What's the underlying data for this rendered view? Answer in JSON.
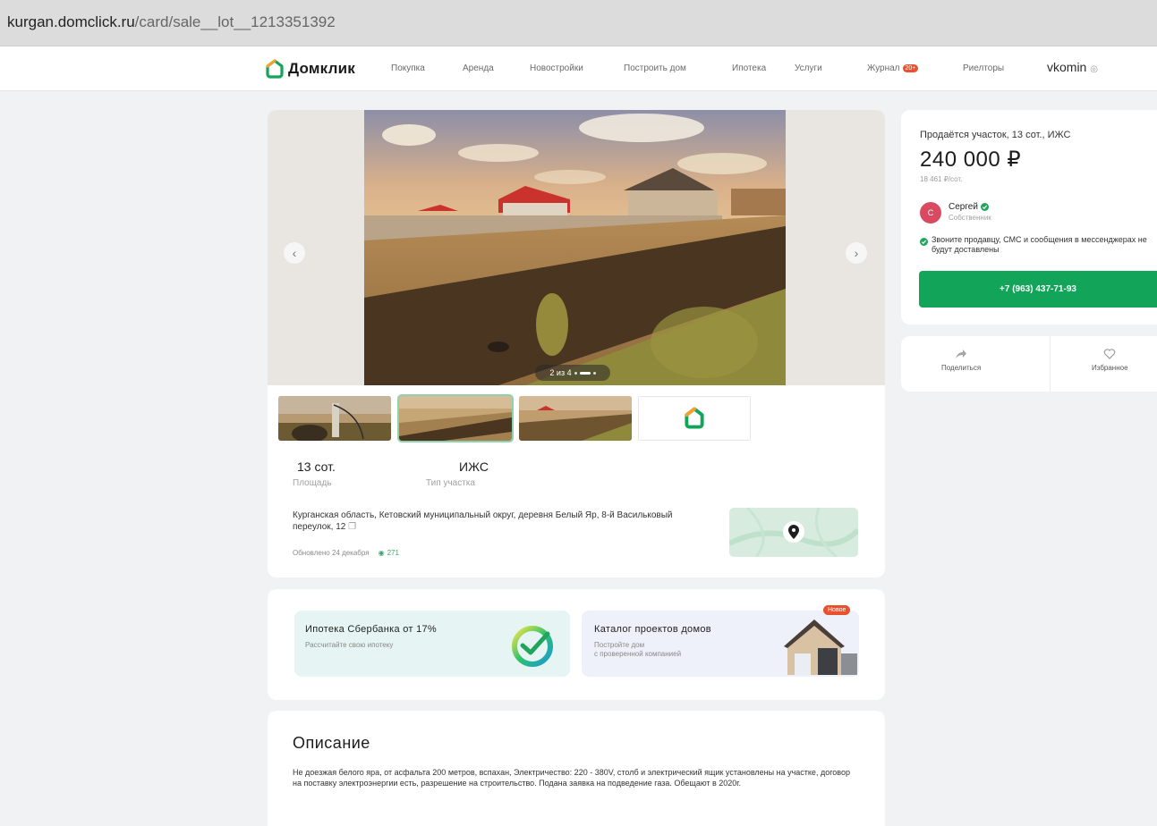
{
  "browser": {
    "url_host": "kurgan.domclick.ru",
    "url_path": "/card/sale__lot__1213351392"
  },
  "nav": {
    "brand": "Домклик",
    "items": [
      "Покупка",
      "Аренда",
      "Новостройки",
      "Построить дом",
      "Ипотека",
      "Услуги",
      "Журнал",
      "Риелторы"
    ],
    "journal_badge": "20+",
    "partner": "vkomin"
  },
  "gallery": {
    "counter": "2 из 4",
    "prev": "‹",
    "next": "›"
  },
  "features": [
    {
      "value": "13 сот.",
      "label": "Площадь"
    },
    {
      "value": "ИЖС",
      "label": "Тип участка"
    }
  ],
  "address": "Курганская область, Кетовский муниципальный округ, деревня Белый Яр, 8-й Васильковый переулок, 12",
  "meta": {
    "updated": "Обновлено 24 декабря",
    "views": "271"
  },
  "promo": {
    "mortgage_title": "Ипотека Сбербанка от 17%",
    "mortgage_sub": "Рассчитайте свою ипотеку",
    "catalog_title": "Каталог проектов домов",
    "catalog_sub_1": "Постройте дом",
    "catalog_sub_2": "с проверенной компанией",
    "new_badge": "Новое"
  },
  "description": {
    "heading": "Описание",
    "text": "Не доезжая белого яра, от асфальта 200 метров, вспахан, Электричество: 220 - 380V, столб и электрический ящик установлены на участке, договор на поставку электроэнергии есть, разрешение на строительство. Подана заявка на подведение газа. Обещают в 2020г."
  },
  "offer": {
    "title": "Продаётся участок, 13 сот., ИЖС",
    "price": "240 000 ₽",
    "price_per_unit": "18 461 ₽/сот.",
    "seller_initial": "С",
    "seller_name": "Сергей",
    "seller_role": "Собственник",
    "notice": "Звоните продавцу, СМС и сообщения в мессенджерах не будут доставлены",
    "phone": "+7 (963) 437-71-93"
  },
  "actions": {
    "share": "Поделиться",
    "favorite": "Избранное"
  },
  "colors": {
    "brand_green": "#12a55a",
    "accent_orange": "#e8512e",
    "avatar": "#d94a61"
  }
}
